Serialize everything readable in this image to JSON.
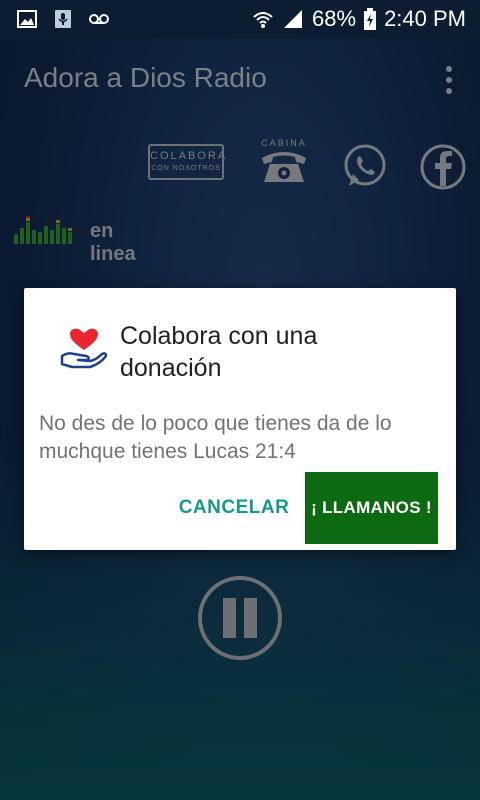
{
  "status_bar": {
    "icons_left": [
      "image-icon",
      "mic-download-icon",
      "voicemail-icon"
    ],
    "icons_right": [
      "wifi-icon",
      "signal-icon"
    ],
    "battery_percent": "68%",
    "time": "2:40 PM"
  },
  "app_bar": {
    "title": "Adora a Dios Radio",
    "menu_icon": "overflow-menu-icon"
  },
  "actions": {
    "colabora_line1": "COLABORA",
    "colabora_line2": "CON NOSOTROS",
    "cabina_label": "CABINA",
    "whatsapp_icon": "whatsapp-icon",
    "facebook_icon": "facebook-icon"
  },
  "stream_status": {
    "label": "en linea",
    "indicator_icon": "equalizer-icon"
  },
  "player": {
    "control_icon": "pause-icon"
  },
  "dialog": {
    "icon": "heart-hand-icon",
    "title": "Colabora con una donación",
    "message": "No des de lo poco que tienes da de lo muchque tienes Lucas 21:4",
    "cancel_label": "CANCELAR",
    "call_label": "¡ LLAMANOS !"
  },
  "colors": {
    "dialog_cancel": "#17988c",
    "dialog_call_bg": "#0c6a12",
    "heart": "#e8262d",
    "hand": "#1e3f8a"
  }
}
